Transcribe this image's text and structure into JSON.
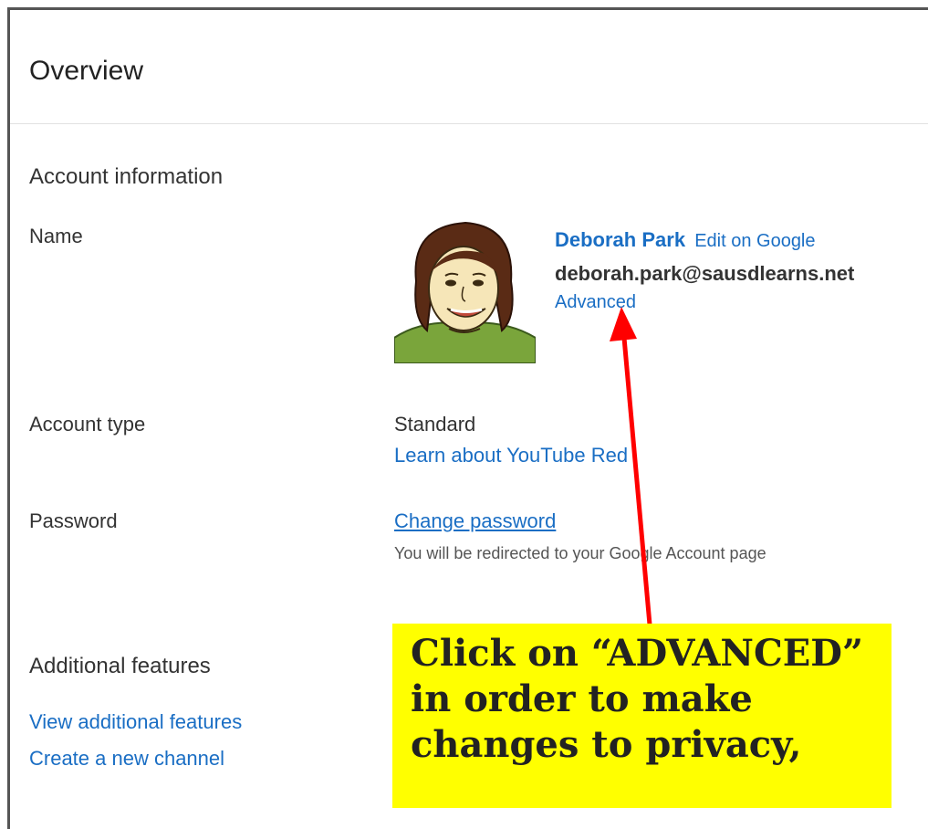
{
  "page": {
    "title": "Overview"
  },
  "account": {
    "section_title": "Account information",
    "name_label": "Name",
    "user_name": "Deborah Park",
    "edit_link": "Edit on Google",
    "email": "deborah.park@sausdlearns.net",
    "advanced_link": "Advanced",
    "type_label": "Account type",
    "type_value": "Standard",
    "learn_link": "Learn about YouTube Red",
    "password_label": "Password",
    "change_password_link": "Change password",
    "redirect_note": "You will be redirected to your Google Account page"
  },
  "additional": {
    "section_title": "Additional features",
    "view_link": "View additional features",
    "create_link": "Create a new channel"
  },
  "annotation": {
    "text": "Click on “ADVANCED” in order to make changes to privacy,",
    "arrow_color": "#ff0000",
    "box_color": "#ffff00"
  }
}
